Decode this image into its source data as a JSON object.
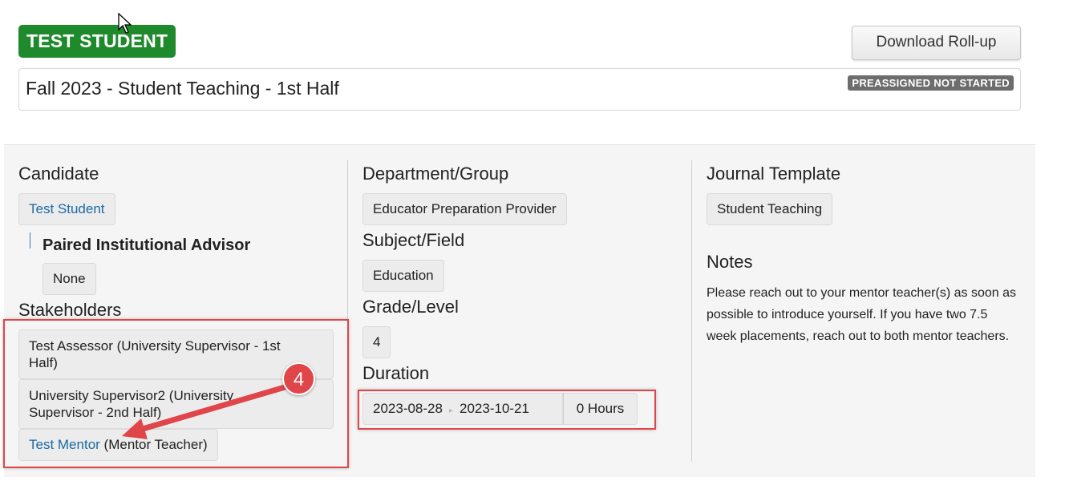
{
  "header": {
    "student_name": "TEST STUDENT",
    "download_label": "Download Roll-up",
    "placement_title": "Fall 2023 - Student Teaching - 1st Half",
    "status": "PREASSIGNED NOT STARTED"
  },
  "candidate": {
    "heading": "Candidate",
    "name": "Test Student",
    "advisor_heading": "Paired Institutional Advisor",
    "advisor_value": "None"
  },
  "stakeholders": {
    "heading": "Stakeholders",
    "items": [
      {
        "line1": "Test Assessor (University Supervisor - 1st",
        "line2": "Half)"
      },
      {
        "line1": "University Supervisor2 (University",
        "line2": "Supervisor - 2nd Half)"
      },
      {
        "link": "Test Mentor",
        "role": " (Mentor Teacher)"
      }
    ]
  },
  "department": {
    "heading": "Department/Group",
    "value": "Educator Preparation Provider"
  },
  "subject": {
    "heading": "Subject/Field",
    "value": "Education"
  },
  "grade": {
    "heading": "Grade/Level",
    "value": "4"
  },
  "duration": {
    "heading": "Duration",
    "start": "2023-08-28",
    "separator": "▸",
    "end": "2023-10-21",
    "hours": "0 Hours"
  },
  "journal": {
    "heading": "Journal Template",
    "value": "Student Teaching"
  },
  "notes": {
    "heading": "Notes",
    "text": "Please reach out to your mentor teacher(s) as soon as possible to introduce yourself. If you have two 7.5 week placements, reach out to both mentor teachers."
  },
  "annotation": {
    "step": "4",
    "color": "#e0454a"
  },
  "colors": {
    "badge_green": "#1f8a2c",
    "link_blue": "#1b6aa5",
    "status_gray": "#6d6d6d"
  }
}
